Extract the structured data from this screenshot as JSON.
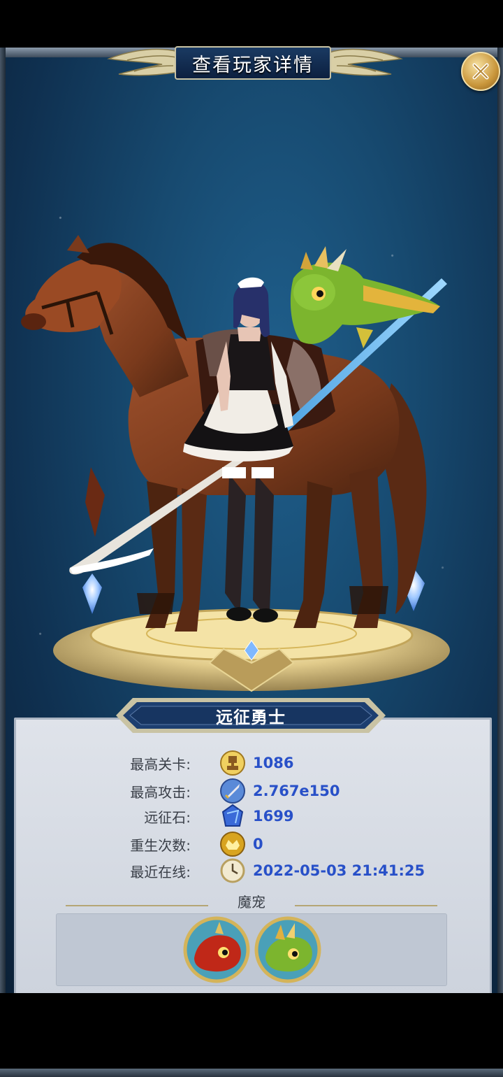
{
  "header": {
    "title": "查看玩家详情"
  },
  "close_button": {
    "icon": "close-icon"
  },
  "player": {
    "rank_title": "远征勇士"
  },
  "stats": [
    {
      "label": "最高关卡:",
      "value": "1086",
      "icon": "trophy-icon"
    },
    {
      "label": "最高攻击:",
      "value": "2.767e150",
      "icon": "sword-icon"
    },
    {
      "label": "远征石:",
      "value": "1699",
      "icon": "expedition-stone-icon"
    },
    {
      "label": "重生次数:",
      "value": "0",
      "icon": "rebirth-icon"
    },
    {
      "label": "最近在线:",
      "value": "2022-05-03 21:41:25",
      "icon": "clock-icon"
    }
  ],
  "pets": {
    "label": "魔宠",
    "items": [
      {
        "icon": "red-dragon-pet-icon"
      },
      {
        "icon": "green-dragon-pet-icon"
      }
    ]
  },
  "colors": {
    "background": "#174a70",
    "stat_value": "#2850c8",
    "panel": "#d8dde5",
    "gold": "#c9963b"
  }
}
